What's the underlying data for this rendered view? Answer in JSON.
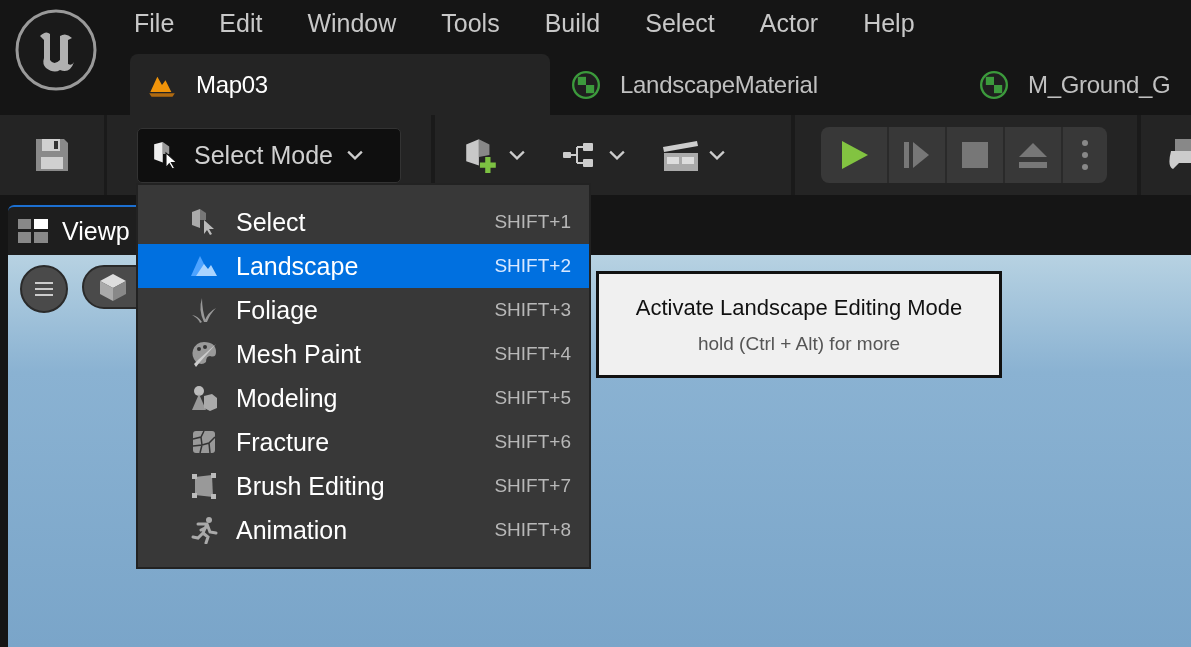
{
  "menu_bar": [
    "File",
    "Edit",
    "Window",
    "Tools",
    "Build",
    "Select",
    "Actor",
    "Help"
  ],
  "tabs": [
    {
      "label": "Map03",
      "kind": "level",
      "selected": true
    },
    {
      "label": "LandscapeMaterial",
      "kind": "material",
      "selected": false
    },
    {
      "label": "M_Ground_G",
      "kind": "material",
      "selected": false
    }
  ],
  "toolbar": {
    "mode_button": "Select Mode"
  },
  "viewport": {
    "tab": "Viewp"
  },
  "mode_menu": [
    {
      "label": "Select",
      "shortcut": "SHIFT+1",
      "selected": false
    },
    {
      "label": "Landscape",
      "shortcut": "SHIFT+2",
      "selected": true
    },
    {
      "label": "Foliage",
      "shortcut": "SHIFT+3",
      "selected": false
    },
    {
      "label": "Mesh Paint",
      "shortcut": "SHIFT+4",
      "selected": false
    },
    {
      "label": "Modeling",
      "shortcut": "SHIFT+5",
      "selected": false
    },
    {
      "label": "Fracture",
      "shortcut": "SHIFT+6",
      "selected": false
    },
    {
      "label": "Brush Editing",
      "shortcut": "SHIFT+7",
      "selected": false
    },
    {
      "label": "Animation",
      "shortcut": "SHIFT+8",
      "selected": false
    }
  ],
  "tooltip": {
    "title": "Activate Landscape Editing Mode",
    "hint": "hold (Ctrl + Alt) for more"
  }
}
